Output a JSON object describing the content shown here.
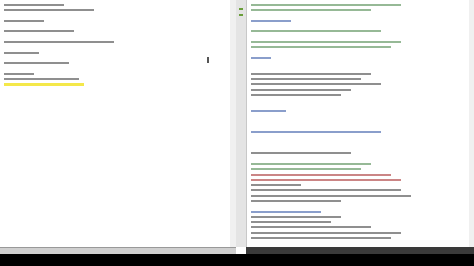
{
  "left_editor": {
    "lines": [
      {
        "text": "",
        "style": "plain",
        "w": 60
      },
      {
        "text": "",
        "style": "plain",
        "w": 90
      },
      {
        "text": "",
        "style": "plain",
        "w": 0
      },
      {
        "text": "",
        "style": "plain",
        "w": 40
      },
      {
        "text": "",
        "style": "plain",
        "w": 0
      },
      {
        "text": "",
        "style": "plain",
        "w": 70
      },
      {
        "text": "",
        "style": "plain",
        "w": 0
      },
      {
        "text": "",
        "style": "plain",
        "w": 110
      },
      {
        "text": "",
        "style": "plain",
        "w": 0
      },
      {
        "text": "",
        "style": "plain",
        "w": 35
      },
      {
        "text": "",
        "style": "plain",
        "w": 0
      },
      {
        "text": "",
        "style": "plain",
        "w": 65
      },
      {
        "text": "",
        "style": "plain",
        "w": 0
      },
      {
        "text": "",
        "style": "plain",
        "w": 30
      },
      {
        "text": "",
        "style": "plain",
        "w": 75
      },
      {
        "text": "",
        "style": "highlight",
        "w": 80
      },
      {
        "text": "",
        "style": "plain",
        "w": 0
      }
    ],
    "status": ""
  },
  "right_editor": {
    "lines": [
      {
        "text": "",
        "style": "green",
        "w": 150
      },
      {
        "text": "",
        "style": "green",
        "w": 120
      },
      {
        "text": "",
        "style": "green",
        "w": 0
      },
      {
        "text": "",
        "style": "blue",
        "w": 40
      },
      {
        "text": "",
        "style": "green",
        "w": 0
      },
      {
        "text": "",
        "style": "green",
        "w": 130
      },
      {
        "text": "",
        "style": "green",
        "w": 0
      },
      {
        "text": "",
        "style": "green",
        "w": 150
      },
      {
        "text": "",
        "style": "green",
        "w": 140
      },
      {
        "text": "",
        "style": "green",
        "w": 0
      },
      {
        "text": "",
        "style": "blue",
        "w": 20
      },
      {
        "text": "",
        "style": "green",
        "w": 0
      },
      {
        "text": "",
        "style": "green",
        "w": 0
      },
      {
        "text": "",
        "style": "plain",
        "w": 120
      },
      {
        "text": "",
        "style": "plain",
        "w": 110
      },
      {
        "text": "",
        "style": "plain",
        "w": 130
      },
      {
        "text": "",
        "style": "plain",
        "w": 100
      },
      {
        "text": "",
        "style": "plain",
        "w": 90
      },
      {
        "text": "",
        "style": "plain",
        "w": 0
      },
      {
        "text": "",
        "style": "green",
        "w": 0
      },
      {
        "text": "",
        "style": "blue",
        "w": 35
      },
      {
        "text": "",
        "style": "green",
        "w": 0
      },
      {
        "text": "",
        "style": "green",
        "w": 0
      },
      {
        "text": "",
        "style": "green",
        "w": 0
      },
      {
        "text": "",
        "style": "blue",
        "w": 130
      },
      {
        "text": "",
        "style": "green",
        "w": 0
      },
      {
        "text": "",
        "style": "green",
        "w": 0
      },
      {
        "text": "",
        "style": "green",
        "w": 0
      },
      {
        "text": "",
        "style": "plain",
        "w": 100
      },
      {
        "text": "",
        "style": "green",
        "w": 0
      },
      {
        "text": "",
        "style": "green",
        "w": 120
      },
      {
        "text": "",
        "style": "green",
        "w": 110
      },
      {
        "text": "",
        "style": "red",
        "w": 140
      },
      {
        "text": "",
        "style": "red",
        "w": 150
      },
      {
        "text": "",
        "style": "plain",
        "w": 50
      },
      {
        "text": "",
        "style": "plain",
        "w": 150
      },
      {
        "text": "",
        "style": "plain",
        "w": 160
      },
      {
        "text": "",
        "style": "plain",
        "w": 90
      },
      {
        "text": "",
        "style": "plain",
        "w": 0
      },
      {
        "text": "",
        "style": "blue",
        "w": 70
      },
      {
        "text": "",
        "style": "plain",
        "w": 90
      },
      {
        "text": "",
        "style": "plain",
        "w": 80
      },
      {
        "text": "",
        "style": "plain",
        "w": 120
      },
      {
        "text": "",
        "style": "plain",
        "w": 150
      },
      {
        "text": "",
        "style": "plain",
        "w": 140
      }
    ],
    "status": ""
  },
  "colors": {
    "status_dark": "#3a3a3a",
    "status_light": "#cfcfcf",
    "highlight": "#f4e84a",
    "comment_green": "#3f7f3f"
  }
}
